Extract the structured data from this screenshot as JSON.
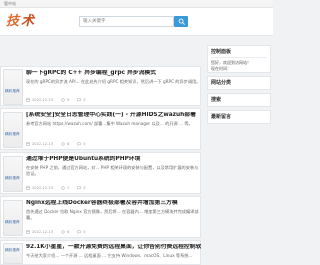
{
  "browser": {
    "top_hint": "管中站"
  },
  "header": {
    "logo_text_1": "技",
    "logo_text_2": "术",
    "search": {
      "placeholder": "输入关键字"
    }
  },
  "posts": [
    {
      "thumb_label": "精彩推荐",
      "title": "聊一下gRPC的 C++ 异步编程_grpc 异步流模式",
      "excerpt": "现在的 gRPC的异步流 API... 在此处先介绍 gRPC 相关知识，然后讲一下 gRPC 的异步调用。",
      "meta": {
        "date": "2022-12-13",
        "views": "9",
        "comments": "0"
      }
    },
    {
      "thumb_label": "精彩推荐",
      "title": "[系统安全]安全日志管理中心实践(一) - 开源HIDS之wazuh部署",
      "excerpt": "参考官方网站 https://wazuh.com/ 部署...集中 Wazuh manager 以及... 的开源 ... 等。",
      "meta": {
        "date": "2022-12-13",
        "views": "8",
        "comments": "0"
      }
    },
    {
      "thumb_label": "精彩推荐",
      "title": "通过堆于PHP便是Ubuntu系统的PHP环境",
      "excerpt": "在安装 PHP 之前，通过官方网站，对... PHP 相关环境的安装与配置，以及常用扩展的安装与验证。",
      "meta": {
        "date": "2022-12-13",
        "views": "7",
        "comments": "0"
      }
    },
    {
      "thumb_label": "精彩推荐",
      "title": "Nginx远程上线Docker容器终极部署及容并增加第三方模",
      "excerpt": "首先通过 Docker 拉取 Nginx 官方镜像，然后将... 在容器内... 增加第三方模块并完成编译部署。",
      "meta": {
        "date": "2022-12-13",
        "views": "6",
        "comments": "0"
      }
    },
    {
      "thumb_label": "精彩推荐",
      "title": "92.1K小星星，一款开源免费的远程桌面，让你告别付费远程控制软件",
      "excerpt": "今天给大家介绍... 一个开源 ... 远程桌面 ... 它支持 Windows、macOS、Linux 等系统...",
      "meta": {
        "date": "2022-12-13",
        "views": "5",
        "comments": "0"
      }
    }
  ],
  "sidebar": {
    "control_panel": {
      "title": "控制面板",
      "lines": [
        "您好，欢迎到访网站！",
        "现在时间："
      ]
    },
    "categories": {
      "title": "网站分类"
    },
    "search_box": {
      "title": "搜索"
    },
    "recent_comments": {
      "title": "最新留言"
    }
  },
  "colors": {
    "accent": "#3a9ad9",
    "logo": "#e06a2a",
    "page_bg": "#f0f2f4"
  },
  "icons": {
    "search": "search-icon",
    "date": "calendar-icon",
    "views": "eye-icon",
    "comments": "comment-icon"
  }
}
